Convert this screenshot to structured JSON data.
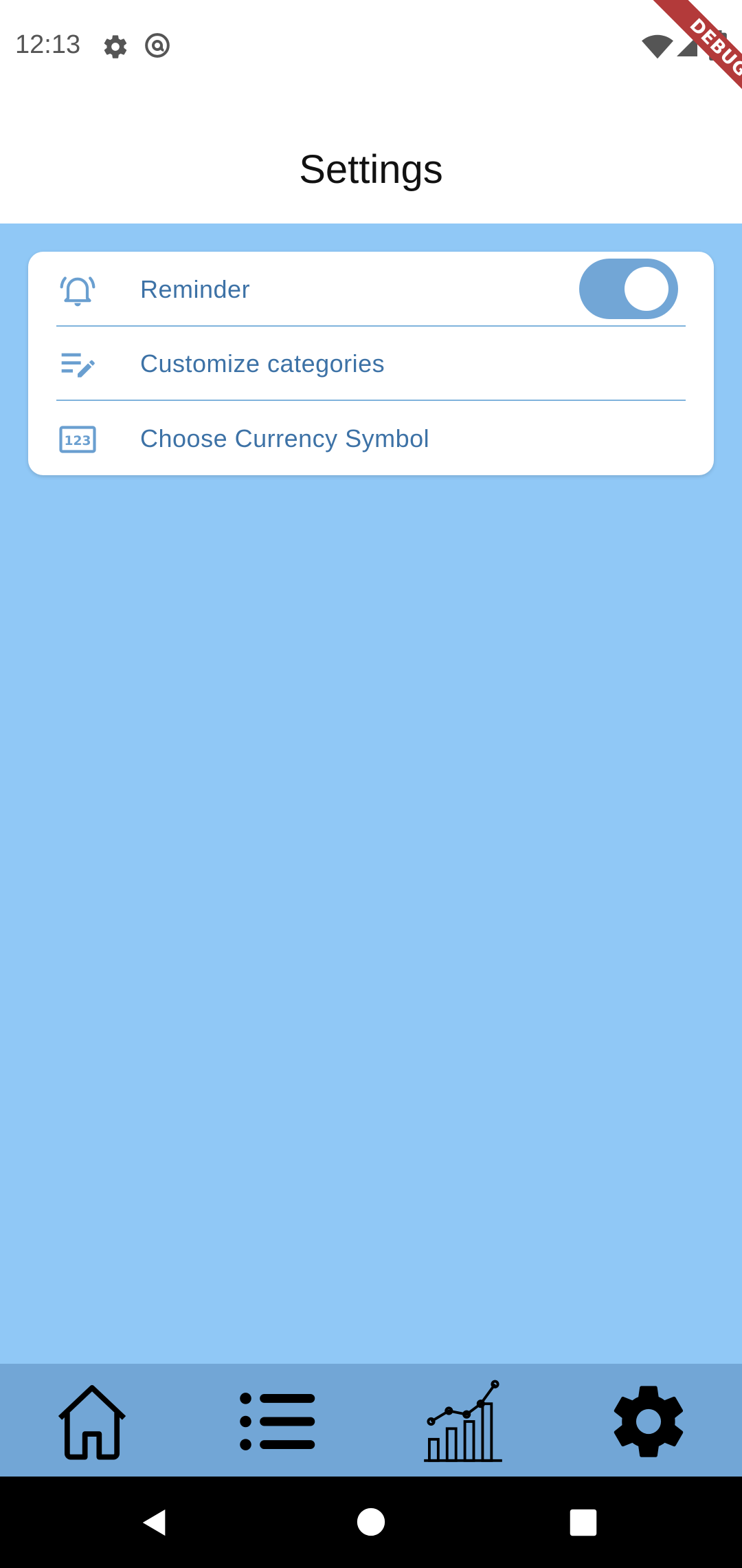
{
  "status_bar": {
    "time": "12:13",
    "icons": [
      "gear-icon",
      "at-sign-icon",
      "wifi-icon",
      "signal-icon",
      "battery-icon"
    ]
  },
  "debug_banner": {
    "label": "DEBUG"
  },
  "app_bar": {
    "title": "Settings"
  },
  "settings": {
    "items": [
      {
        "label": "Reminder",
        "icon": "alarm-bell-icon",
        "toggle": true
      },
      {
        "label": "Customize categories",
        "icon": "edit-list-icon"
      },
      {
        "label": "Choose Currency Symbol",
        "icon": "numbers-123-icon",
        "icon_text": "123"
      }
    ]
  },
  "bottom_nav": {
    "items": [
      "home-icon",
      "list-icon",
      "chart-icon",
      "settings-icon"
    ],
    "active": "settings-icon"
  },
  "system_nav": {
    "items": [
      "back-icon",
      "home-circle-icon",
      "recents-icon"
    ]
  },
  "colors": {
    "background": "#90c8f6",
    "accent": "#72a6d6",
    "text_primary": "#3d72a6",
    "debug": "#b33a3a"
  }
}
